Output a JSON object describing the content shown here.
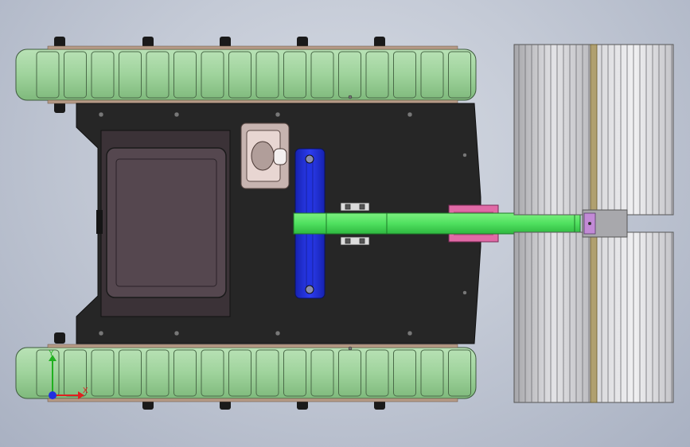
{
  "window": {
    "title": ""
  },
  "viewport": {
    "background_top": "#d6dbe4",
    "background_bottom": "#a9b1c2"
  },
  "model": {
    "track_color": "#9fd39c",
    "chassis_color": "#262626",
    "battery_color": "#55474f",
    "servo_color": "#1f2fd6",
    "arm_color": "#4fe05f",
    "bracket_color": "#e06aa6",
    "brush_color": "#c9c9cc",
    "wheel_count": 5
  },
  "triad": {
    "x_label": "X",
    "y_label": "Y",
    "x_color": "#e02020",
    "y_color": "#20b020",
    "z_color": "#2030e0"
  }
}
